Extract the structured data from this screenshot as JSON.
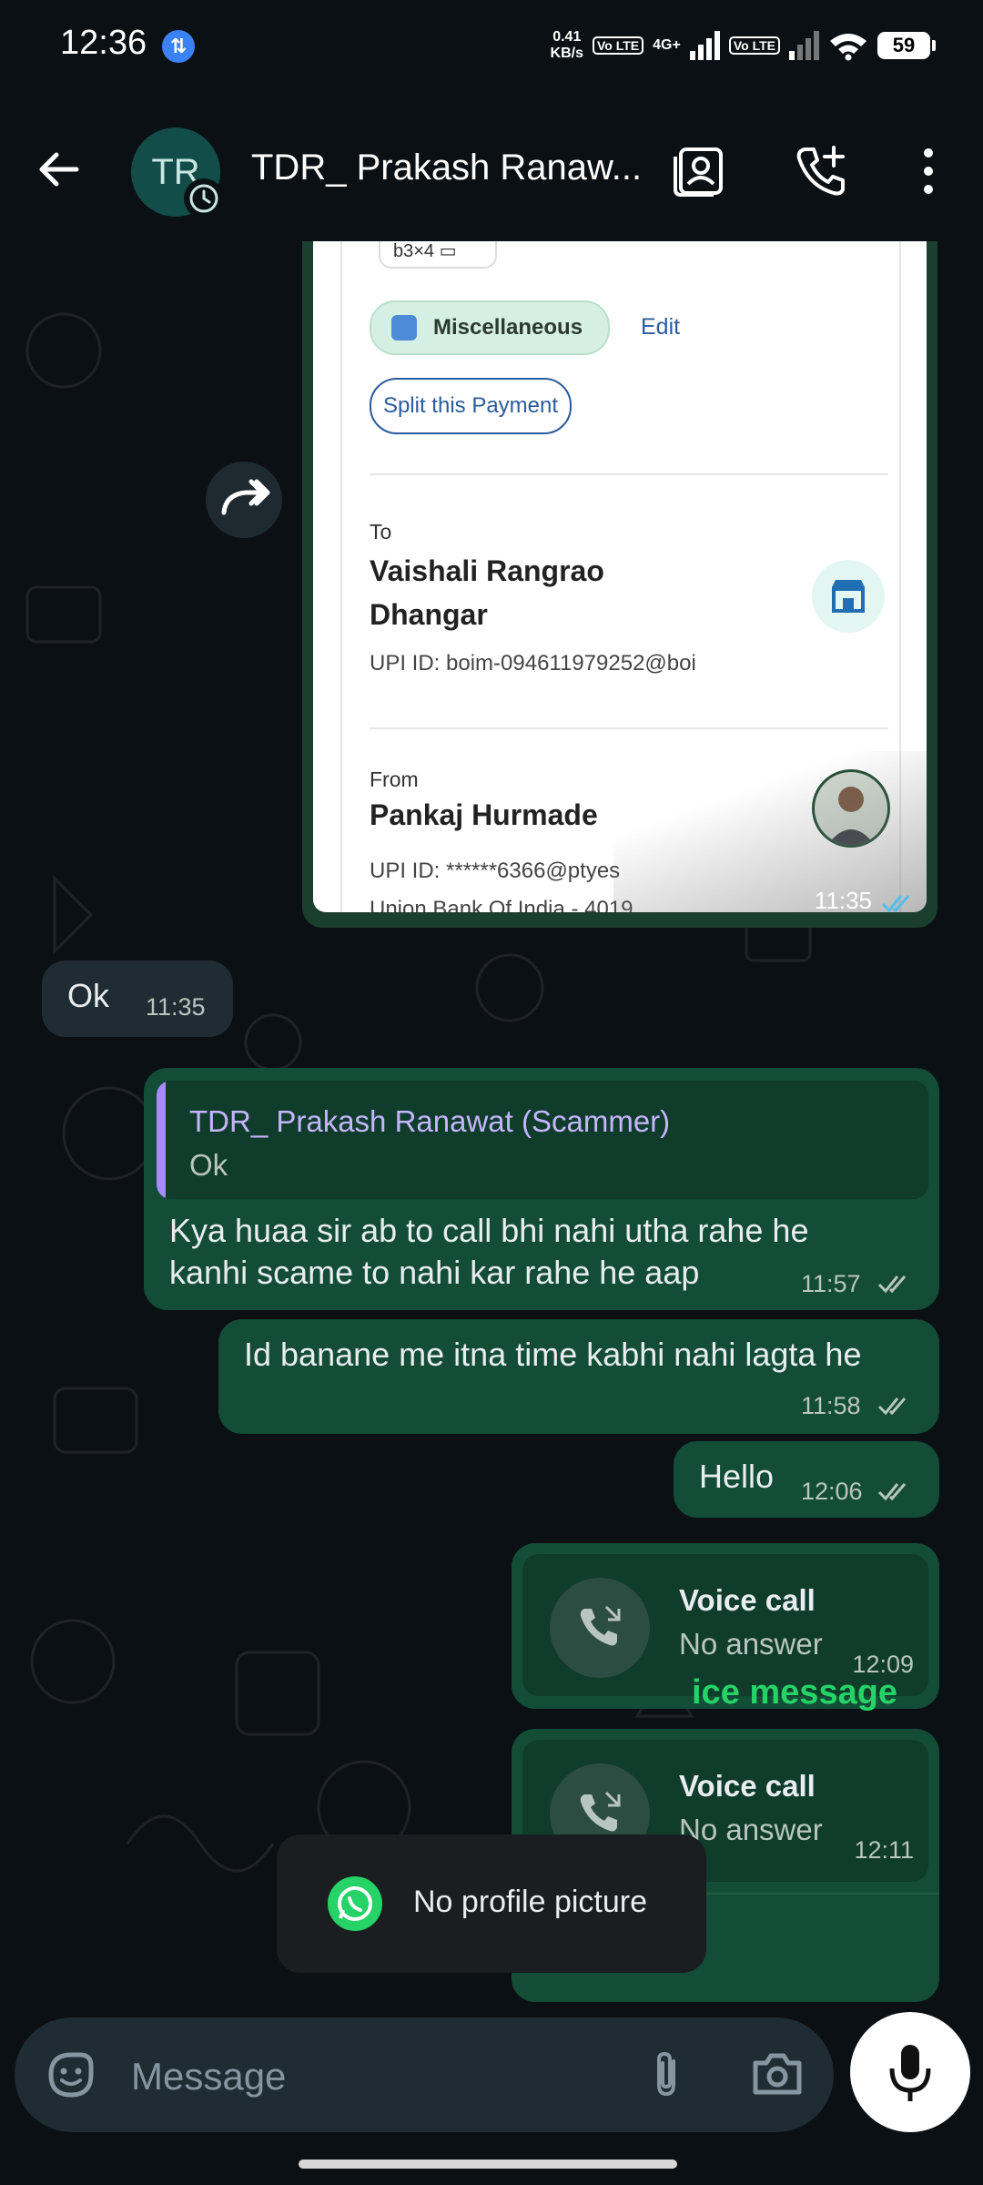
{
  "status_bar": {
    "time": "12:36",
    "sync_icon": "data-sync-icon",
    "net_speed_value": "0.41",
    "net_speed_unit": "KB/s",
    "volte1": "Vo LTE",
    "network_type": "4G+",
    "volte2": "Vo LTE",
    "battery": "59"
  },
  "header": {
    "avatar_initials": "TR",
    "title": "TDR_ Prakash Ranaw...",
    "icons": [
      "back-arrow-icon",
      "contact-card-icon",
      "add-call-icon",
      "more-options-icon"
    ]
  },
  "payment_card": {
    "chip_code": "b3×4",
    "category": "Miscellaneous",
    "edit_label": "Edit",
    "split_label": "Split this Payment",
    "to_label": "To",
    "to_name_line1": "Vaishali Rangrao",
    "to_name_line2": "Dhangar",
    "to_upi": "UPI ID: boim-094611979252@boi",
    "from_label": "From",
    "from_name": "Pankaj Hurmade",
    "from_upi": "UPI ID: ******6366@ptyes",
    "from_bank": "Union Bank Of India - 4019",
    "time": "11:35"
  },
  "messages": {
    "m1_text": "Ok",
    "m1_time": "11:35",
    "m2_quote_name": "TDR_ Prakash Ranawat (Scammer)",
    "m2_quote_text": "Ok",
    "m2_line1": "Kya huaa sir ab to call bhi nahi utha rahe he",
    "m2_line2": "kanhi scame to nahi kar rahe he aap",
    "m2_time": "11:57",
    "m3_text": "Id banane me itna time kabhi nahi lagta he",
    "m3_time": "11:58",
    "m4_text": "Hello",
    "m4_time": "12:06",
    "call1_title": "Voice call",
    "call1_sub": "No answer",
    "call1_time": "12:09",
    "call2_title": "Voice call",
    "call2_sub": "No answer",
    "call2_time": "12:11",
    "voice_partial": "ice message"
  },
  "toast": {
    "text": "No profile picture"
  },
  "input": {
    "placeholder": "Message"
  },
  "colors": {
    "background": "#0b1014",
    "outgoing_bubble": "#134d37",
    "incoming_bubble": "#1f2c33",
    "accent_green": "#25d366",
    "read_tick_blue": "#53bdeb"
  }
}
